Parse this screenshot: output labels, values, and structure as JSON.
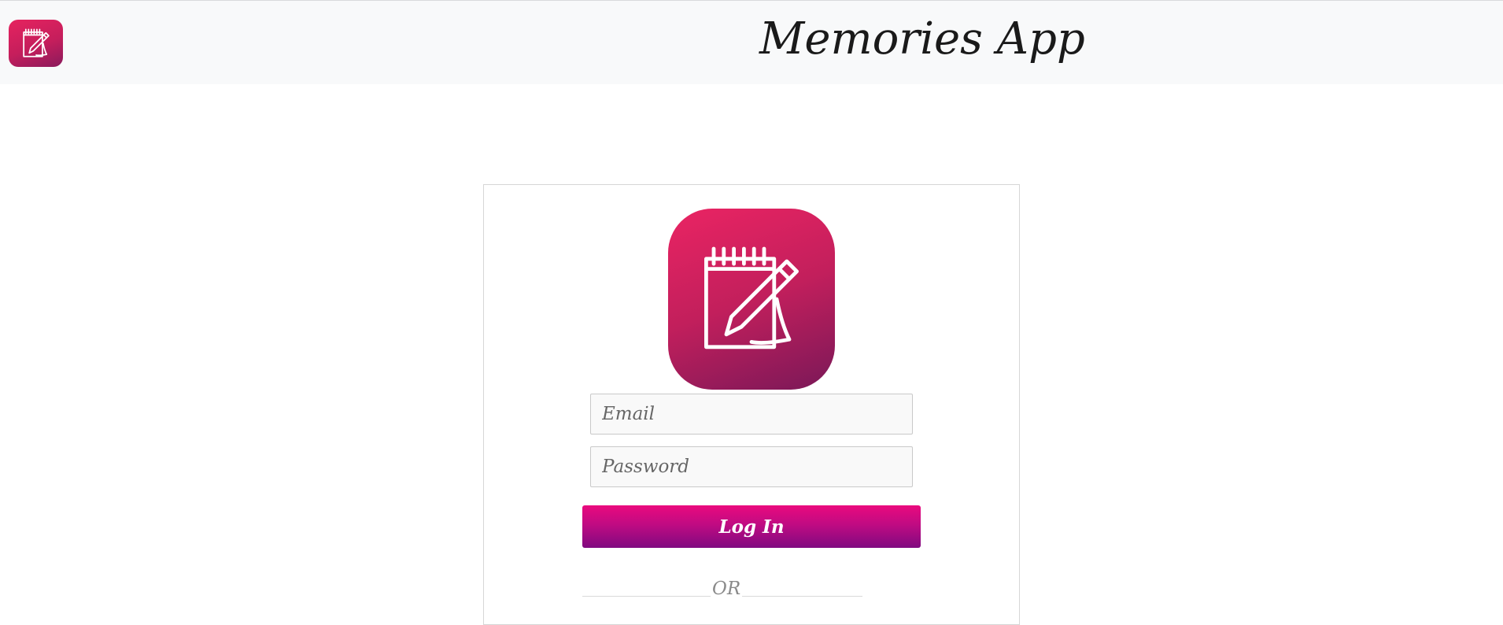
{
  "navbar": {
    "logo_icon": "notepad-pen-icon",
    "title": "Memories App"
  },
  "login": {
    "app_icon": "notepad-pen-icon",
    "email_placeholder": "Email",
    "email_value": "",
    "password_placeholder": "Password",
    "password_value": "",
    "login_label": "Log In",
    "or_label": "OR"
  },
  "colors": {
    "brand_pink": "#e6235f",
    "brand_purple": "#800a80",
    "navbar_bg": "#f8f9fa"
  }
}
